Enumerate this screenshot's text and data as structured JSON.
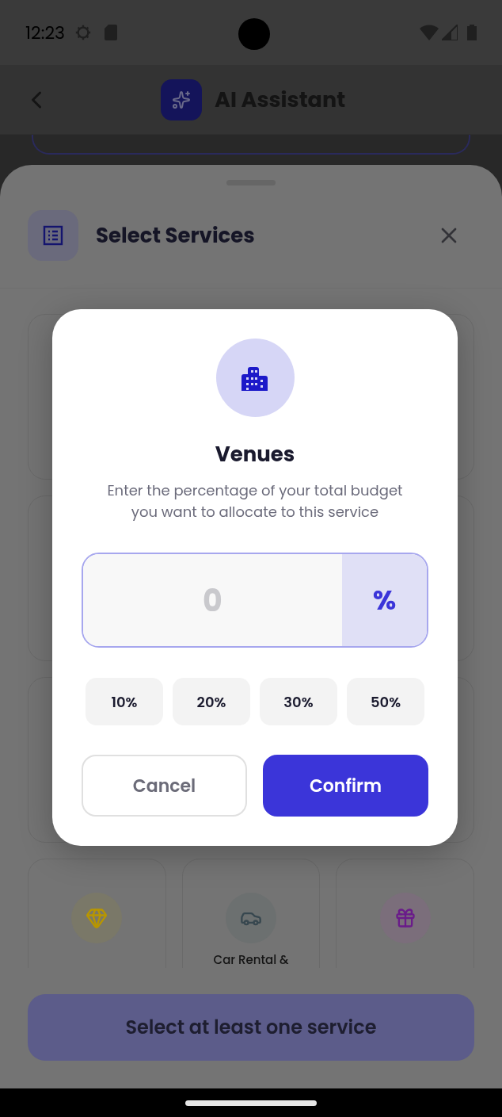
{
  "status_bar": {
    "time": "12:23"
  },
  "header": {
    "title": "AI Assistant"
  },
  "sheet": {
    "title": "Select Services",
    "services": [
      {
        "kind": "jewelry"
      },
      {
        "kind": "car",
        "label": "Car Rental &"
      },
      {
        "kind": "gift"
      }
    ]
  },
  "dialog": {
    "title": "Venues",
    "description": "Enter the percentage of your total budget you want to allocate to this service",
    "input": {
      "placeholder": "0",
      "unit": "%"
    },
    "presets": [
      "10%",
      "20%",
      "30%",
      "50%"
    ],
    "buttons": [
      {
        "label": "Cancel",
        "kind": "secondary"
      },
      {
        "label": "Confirm",
        "kind": "primary"
      }
    ]
  },
  "submit_button": {
    "label": "Select at least one service",
    "disabled": true
  }
}
